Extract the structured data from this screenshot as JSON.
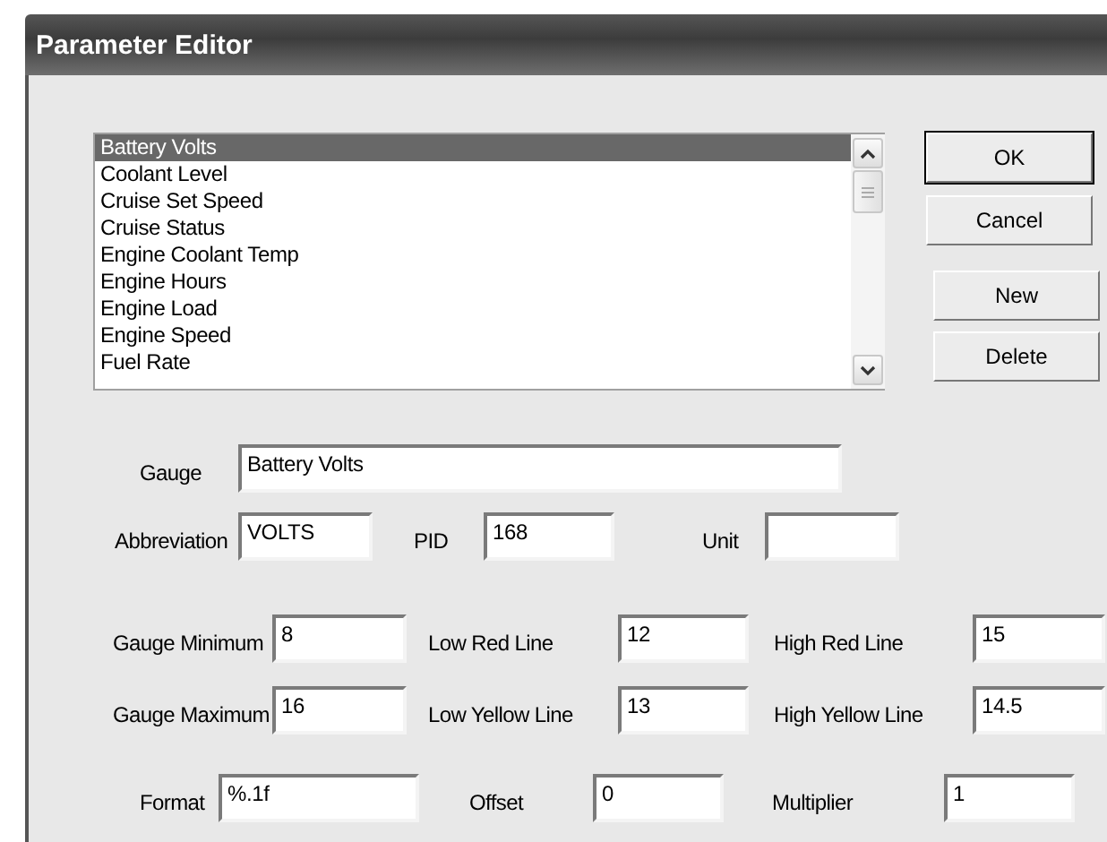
{
  "window": {
    "title": "Parameter Editor"
  },
  "gauge_list": {
    "items": [
      {
        "label": "Battery Volts",
        "selected": true
      },
      {
        "label": "Coolant Level",
        "selected": false
      },
      {
        "label": "Cruise Set Speed",
        "selected": false
      },
      {
        "label": "Cruise Status",
        "selected": false
      },
      {
        "label": "Engine Coolant Temp",
        "selected": false
      },
      {
        "label": "Engine Hours",
        "selected": false
      },
      {
        "label": "Engine Load",
        "selected": false
      },
      {
        "label": "Engine Speed",
        "selected": false
      },
      {
        "label": "Fuel Rate",
        "selected": false
      }
    ]
  },
  "buttons": [
    {
      "label": "OK",
      "default": true
    },
    {
      "label": "Cancel",
      "default": false
    },
    {
      "label": "New",
      "default": false
    },
    {
      "label": "Delete",
      "default": false
    }
  ],
  "form_rows": [
    [
      {
        "label": "Gauge",
        "value": "Battery Volts"
      }
    ],
    [
      {
        "label": "Abbreviation",
        "value": "VOLTS"
      },
      {
        "label": "PID",
        "value": "168"
      },
      {
        "label": "Unit"
      }
    ],
    [
      {
        "label": "Gauge Minimum",
        "value": "8"
      },
      {
        "label": "Low Red Line",
        "value": "12"
      },
      {
        "label": "High Red Line",
        "value": "15"
      }
    ],
    [
      {
        "label": "Gauge Maximum",
        "value": "16"
      },
      {
        "label": "Low Yellow Line",
        "value": "13"
      },
      {
        "label": "High Yellow Line",
        "value": "14.5"
      }
    ],
    [
      {
        "label": "Format",
        "value": "%.1f"
      },
      {
        "label": "Offset",
        "value": "0"
      },
      {
        "label": "Multiplier",
        "value": "1"
      }
    ]
  ]
}
